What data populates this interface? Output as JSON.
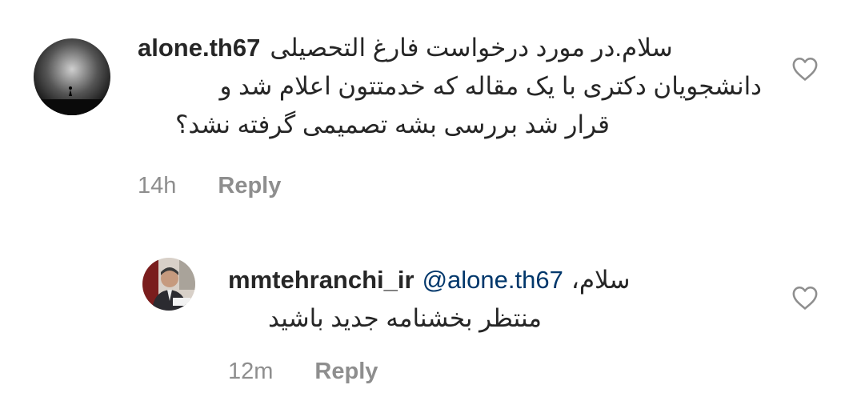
{
  "comments": [
    {
      "username": "alone.th67",
      "text_line1": "سلام.در مورد درخواست فارغ التحصیلی",
      "text_line2": "دانشجویان دکتری با یک مقاله که خدمتتون اعلام شد و",
      "text_line3": "قرار شد بررسی بشه تصمیمی گرفته نشد؟",
      "time": "14h",
      "reply_label": "Reply",
      "avatar_icon": "avatar-silhouette-dark",
      "like_icon": "heart-outline-icon"
    },
    {
      "username": "mmtehranchi_ir",
      "mention": "@alone.th67",
      "text_line1": "سلام،",
      "text_line2": "منتظر بخشنامه جدید باشید",
      "time": "12m",
      "reply_label": "Reply",
      "avatar_icon": "avatar-photo-man",
      "like_icon": "heart-outline-icon"
    }
  ],
  "colors": {
    "text": "#262626",
    "meta": "#8e8e8e",
    "mention": "#00376b",
    "icon_stroke": "#8e8e8e"
  }
}
